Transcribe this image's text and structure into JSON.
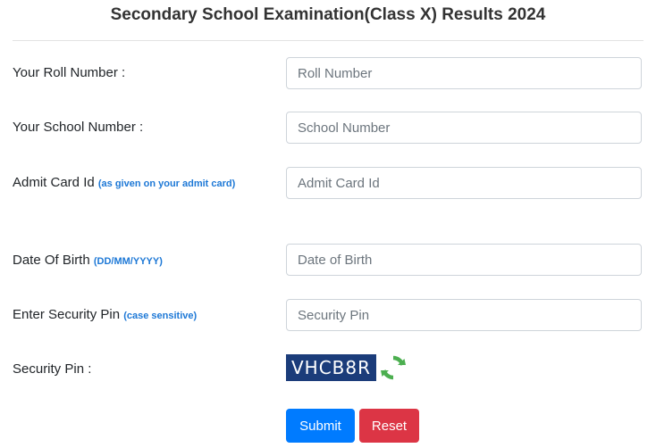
{
  "page": {
    "title": "Secondary School Examination(Class X) Results 2024"
  },
  "form": {
    "roll_number": {
      "label": "Your Roll Number :",
      "placeholder": "Roll Number"
    },
    "school_number": {
      "label": "Your School Number :",
      "placeholder": "School Number"
    },
    "admit_card": {
      "label": "Admit Card Id",
      "hint": "(as given on your admit card)",
      "placeholder": "Admit Card Id"
    },
    "dob": {
      "label": "Date Of Birth",
      "hint": "(DD/MM/YYYY)",
      "placeholder": "Date of Birth"
    },
    "security_pin_input": {
      "label": "Enter Security Pin",
      "hint": "(case sensitive)",
      "placeholder": "Security Pin"
    },
    "security_pin": {
      "label": "Security Pin :",
      "captcha": "VHCB8R",
      "refresh_icon": "refresh-icon"
    }
  },
  "buttons": {
    "submit": "Submit",
    "reset": "Reset"
  },
  "colors": {
    "submit": "#007bff",
    "reset": "#dc3545",
    "hint": "#1d78d6",
    "captcha_bg": "#1b3c7a",
    "refresh_icon": "#4caf50"
  }
}
